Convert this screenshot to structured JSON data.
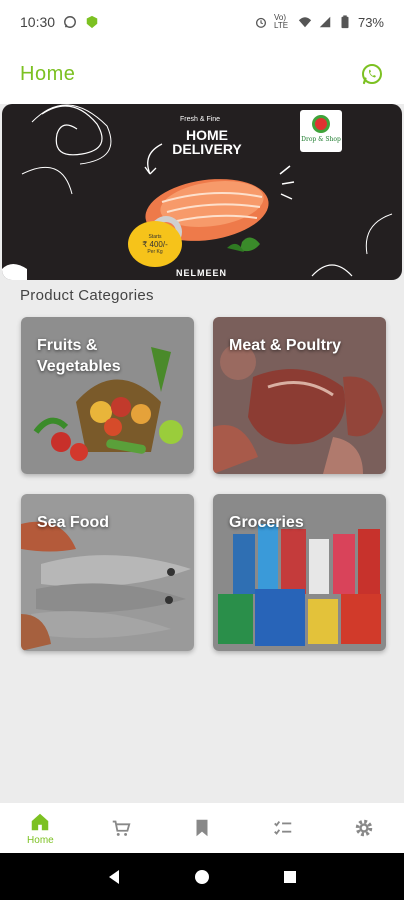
{
  "status_bar": {
    "time": "10:30",
    "battery": "73%",
    "network": "Vo) LTE"
  },
  "app_bar": {
    "title": "Home",
    "whatsapp_icon": "whatsapp-icon",
    "accent_color": "#7cc122"
  },
  "banner": {
    "tagline": "Fresh & Fine",
    "headline_1": "HOME",
    "headline_2": "DELIVERY",
    "logo_text": "Drop & Shop",
    "price_top": "Starts",
    "price": "₹ 400/-",
    "price_unit": "Per Kg",
    "bottom_text": "NELMEEN"
  },
  "section_title": "Product Categories",
  "categories": [
    {
      "label_1": "Fruits &",
      "label_2": "Vegetables"
    },
    {
      "label_1": "Meat & Poultry",
      "label_2": ""
    },
    {
      "label_1": "Sea Food",
      "label_2": ""
    },
    {
      "label_1": "Groceries",
      "label_2": ""
    }
  ],
  "bottom_nav": {
    "items": [
      {
        "icon": "home-icon",
        "label": "Home",
        "active": true
      },
      {
        "icon": "cart-icon",
        "label": "",
        "active": false
      },
      {
        "icon": "bookmark-icon",
        "label": "",
        "active": false
      },
      {
        "icon": "checklist-icon",
        "label": "",
        "active": false
      },
      {
        "icon": "gear-icon",
        "label": "",
        "active": false
      }
    ]
  }
}
